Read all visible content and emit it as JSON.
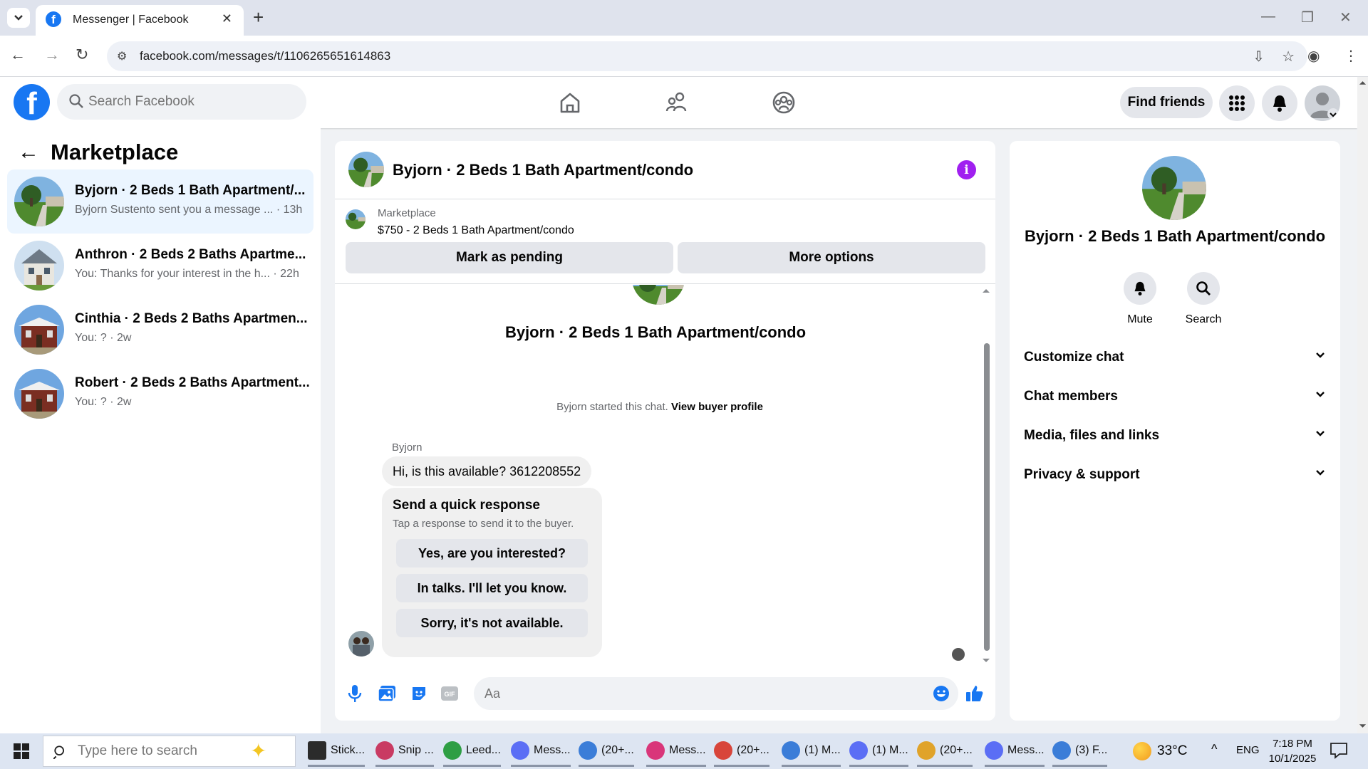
{
  "browser": {
    "tab_title": "Messenger | Facebook",
    "url": "facebook.com/messages/t/1106265651614863",
    "tab_close": "✕",
    "new_tab": "+"
  },
  "fb_nav": {
    "logo_letter": "f",
    "search_placeholder": "Search Facebook",
    "find_friends": "Find friends"
  },
  "sidebar": {
    "title": "Marketplace",
    "conversations": [
      {
        "name": "Byjorn · 2 Beds 1 Bath Apartment/...",
        "preview": "Byjorn Sustento sent you a message ... · 13h",
        "active": true
      },
      {
        "name": "Anthron · 2 Beds 2 Baths Apartme...",
        "preview": "You: Thanks for your interest in the h... · 22h"
      },
      {
        "name": "Cinthia · 2 Beds 2 Baths Apartmen...",
        "preview": "You: ? · 2w"
      },
      {
        "name": "Robert · 2 Beds 2 Baths Apartment...",
        "preview": "You: ? · 2w"
      }
    ]
  },
  "chat": {
    "title": "Byjorn · 2 Beds 1 Bath Apartment/condo",
    "listing": {
      "category": "Marketplace",
      "description": "$750 - 2 Beds 1 Bath Apartment/condo",
      "mark_pending": "Mark as pending",
      "more_options": "More options"
    },
    "thread_title": "Byjorn · 2 Beds 1 Bath Apartment/condo",
    "started_text": "Byjorn started this chat.",
    "view_buyer": "View buyer profile",
    "sender": "Byjorn",
    "message": "Hi, is this available? 3612208552",
    "quick_response": {
      "title": "Send a quick response",
      "subtitle": "Tap a response to send it to the buyer.",
      "options": [
        "Yes, are you interested?",
        "In talks. I'll let you know.",
        "Sorry, it's not available."
      ]
    },
    "composer_placeholder": "Aa"
  },
  "info_panel": {
    "title": "Byjorn · 2 Beds 1 Bath Apartment/condo",
    "actions": [
      {
        "label": "Mute"
      },
      {
        "label": "Search"
      }
    ],
    "sections": [
      "Customize chat",
      "Chat members",
      "Media, files and links",
      "Privacy & support"
    ]
  },
  "taskbar": {
    "search_placeholder": "Type here to search",
    "apps": [
      {
        "label": "Stick...",
        "color": "#2b2b2b"
      },
      {
        "label": "Snip ...",
        "color": "#c93b63"
      },
      {
        "label": "Leed...",
        "color": "#2e9e44"
      },
      {
        "label": "Mess...",
        "color": "#5b6ef5"
      },
      {
        "label": "(20+...",
        "color": "#3b7dd8"
      },
      {
        "label": "Mess...",
        "color": "#d9367a"
      },
      {
        "label": "(20+...",
        "color": "#d8453b"
      },
      {
        "label": "(1) M...",
        "color": "#3b7dd8"
      },
      {
        "label": "(1) M...",
        "color": "#5b6ef5"
      },
      {
        "label": "(20+...",
        "color": "#e0a32a"
      },
      {
        "label": "Mess...",
        "color": "#5b6ef5"
      },
      {
        "label": "(3) F...",
        "color": "#3b7dd8"
      }
    ],
    "weather": "33°C",
    "language": "ENG",
    "time": "7:18 PM",
    "date": "10/1/2025"
  },
  "colors": {
    "fb_blue": "#1877f2",
    "info_purple": "#a020f0",
    "active_row": "#ebf5ff"
  }
}
